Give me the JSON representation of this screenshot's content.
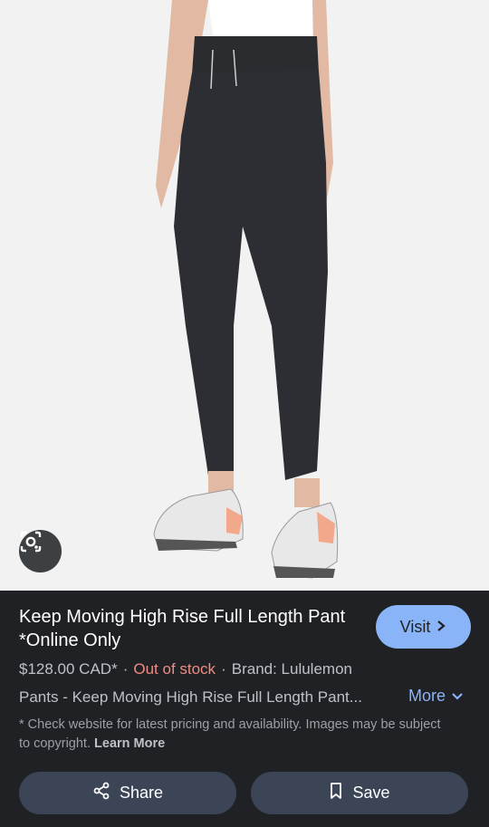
{
  "product": {
    "title": "Keep Moving High Rise Full Length Pant *Online Only",
    "price": "$128.00 CAD*",
    "stock_status": "Out of stock",
    "brand": "Brand: Lululemon",
    "separator": "·",
    "description": "Pants - Keep Moving High Rise Full Length Pant..."
  },
  "buttons": {
    "visit": "Visit",
    "more": "More",
    "share": "Share",
    "save": "Save"
  },
  "disclaimer": {
    "text": "* Check website for latest pricing and availability. Images may be subject to copyright.",
    "learn_more": "Learn More"
  },
  "icons": {
    "lens": "lens-icon",
    "visit": "chevron-right-icon",
    "more": "chevron-down-icon",
    "share": "share-icon",
    "save": "bookmark-icon"
  },
  "colors": {
    "background": "#202124",
    "accent": "#8ab4f8",
    "out_of_stock": "#f28b82",
    "action_button": "#3c4556"
  }
}
